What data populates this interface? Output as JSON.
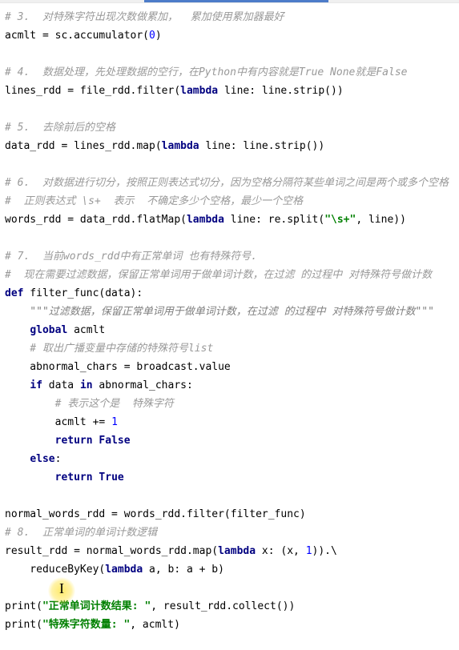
{
  "topbar": {
    "progress": true
  },
  "code": {
    "c3": "# 3.  对特殊字符出现次数做累加，  累加使用累加器最好",
    "l3": {
      "a": "acmlt = sc.accumulator(",
      "n": "0",
      "b": ")"
    },
    "c4": "# 4.  数据处理，先处理数据的空行，在Python中有内容就是True None就是False",
    "l4": {
      "a": "lines_rdd = file_rdd.filter(",
      "kw": "lambda",
      "b": " line: line.strip())"
    },
    "c5": "# 5.  去除前后的空格",
    "l5": {
      "a": "data_rdd = lines_rdd.map(",
      "kw": "lambda",
      "b": " line: line.strip())"
    },
    "c6a": "# 6.  对数据进行切分，按照正则表达式切分，因为空格分隔符某些单词之间是两个或多个空格",
    "c6b": "#  正则表达式 \\s+  表示  不确定多少个空格，最少一个空格",
    "l6": {
      "a": "words_rdd = data_rdd.flatMap(",
      "kw": "lambda",
      "b": " line: re.split(",
      "s": "\"\\s+\"",
      "c": ", line))"
    },
    "c7a": "# 7.  当前words_rdd中有正常单词 也有特殊符号.",
    "c7b": "#  现在需要过滤数据，保留正常单词用于做单词计数，在过滤 的过程中 对特殊符号做计数",
    "def": {
      "kw": "def",
      "name": " filter_func(data):"
    },
    "doc": "    \"\"\"过滤数据，保留正常单词用于做单词计数，在过滤 的过程中 对特殊符号做计数\"\"\"",
    "glb": {
      "kw": "global",
      "t": " acmlt"
    },
    "cfa": "    # 取出广播变量中存储的特殊符号list",
    "abn": "    abnormal_chars = broadcast.value",
    "ifl": {
      "kw1": "if",
      "mid": " data ",
      "kw2": "in",
      "t": " abnormal_chars:"
    },
    "cfa2": "        # 表示这个是  特殊字符",
    "inc": {
      "a": "        acmlt += ",
      "n": "1"
    },
    "rF": {
      "pad": "        ",
      "kw": "return False"
    },
    "els": {
      "pad": "    ",
      "kw": "else",
      "t": ":"
    },
    "rT": {
      "pad": "        ",
      "kw": "return True"
    },
    "nrm": "normal_words_rdd = words_rdd.filter(filter_func)",
    "c8": "# 8.  正常单词的单词计数逻辑",
    "res": {
      "a": "result_rdd = normal_words_rdd.map(",
      "kw": "lambda",
      "b": " x: (x, ",
      "n": "1",
      "c": ")).\\"
    },
    "red": {
      "a": "    reduceByKey(",
      "kw": "lambda",
      "b": " a, b: a + b)"
    },
    "p1": {
      "a": "print(",
      "s": "\"正常单词计数结果: \"",
      "b": ", result_rdd.collect())"
    },
    "p2": {
      "a": "print(",
      "s": "\"特殊字符数量: \"",
      "b": ", acmlt)"
    }
  },
  "cursor": {
    "glyph": "I"
  }
}
